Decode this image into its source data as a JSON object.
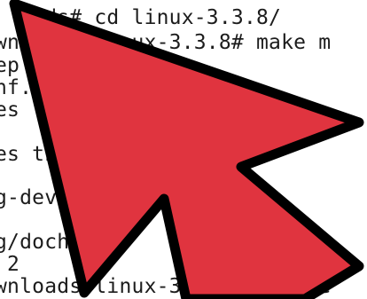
{
  "terminal": {
    "lines": [
      "    ds# cd linux-3.3.8/",
      "wn       inux-3.3.8# make m",
      "ep",
      "nf.o",
      "es l",
      "",
      "es the           ries.",
      "",
      "g-devel)",
      "",
      "g/docheck      log]",
      " 2",
      "wnloads/linux-3.3.8# apt-ge"
    ]
  },
  "pointer": {
    "icon": "mouse-cursor-arrow-icon",
    "fill_color": "#e0343f",
    "outline_color": "#000000"
  }
}
